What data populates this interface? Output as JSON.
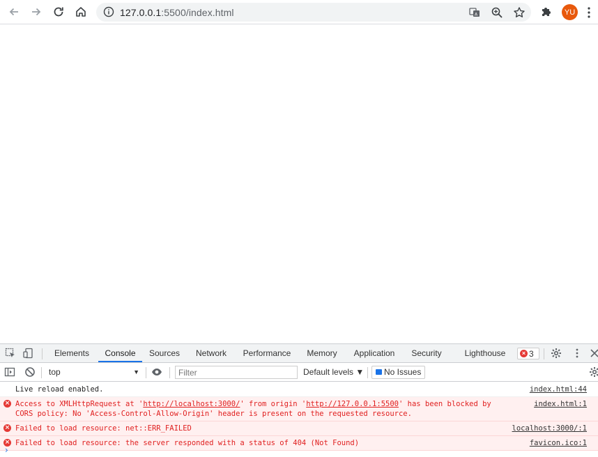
{
  "browser": {
    "url_host": "127.0.0.1",
    "url_rest": ":5500/index.html",
    "avatar_initials": "YU"
  },
  "devtools": {
    "tabs": [
      {
        "label": "Elements"
      },
      {
        "label": "Console"
      },
      {
        "label": "Sources"
      },
      {
        "label": "Network"
      },
      {
        "label": "Performance"
      },
      {
        "label": "Memory"
      },
      {
        "label": "Application"
      },
      {
        "label": "Security"
      },
      {
        "label": "Lighthouse"
      }
    ],
    "active_tab": "Console",
    "error_count": "3",
    "context": "top",
    "filter_placeholder": "Filter",
    "levels_label": "Default levels ▼",
    "issues_label": "No Issues"
  },
  "console": {
    "messages": [
      {
        "type": "info",
        "text": "Live reload enabled.",
        "source": "index.html:44"
      },
      {
        "type": "error",
        "text_a": "Access to XMLHttpRequest at '",
        "link_a": "http://localhost:3000/",
        "text_b": "' from origin '",
        "link_b": "http://127.0.0.1:5500",
        "text_c": "' has been blocked by",
        "text_d": "CORS policy: No 'Access-Control-Allow-Origin' header is present on the requested resource.",
        "source": "index.html:1"
      },
      {
        "type": "error",
        "text": "Failed to load resource: net::ERR_FAILED",
        "source": "localhost:3000/:1"
      },
      {
        "type": "error",
        "text": "Failed to load resource: the server responded with a status of 404 (Not Found)",
        "source": "favicon.ico:1"
      }
    ]
  },
  "colors": {
    "accent": "#1a73e8",
    "error": "#e53935",
    "avatar": "#e8590c"
  }
}
